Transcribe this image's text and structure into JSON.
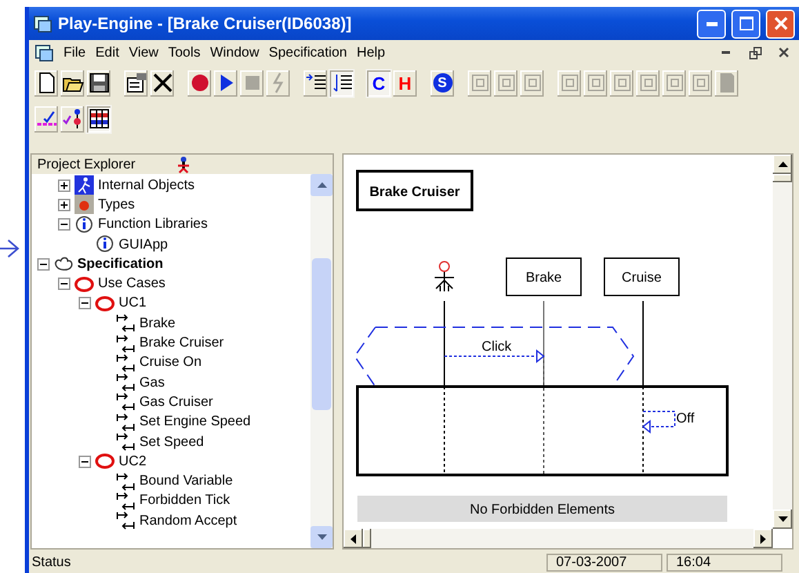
{
  "window": {
    "title": "Play-Engine - [Brake Cruiser(ID6038)]"
  },
  "menu": [
    "File",
    "Edit",
    "View",
    "Tools",
    "Window",
    "Specification",
    "Help"
  ],
  "toolbar_rows": [
    [
      {
        "kind": "new",
        "disabled": false
      },
      {
        "kind": "open",
        "disabled": false
      },
      {
        "kind": "save",
        "disabled": false
      },
      {
        "kind": "gap"
      },
      {
        "kind": "properties",
        "disabled": false
      },
      {
        "kind": "delete",
        "disabled": false
      },
      {
        "kind": "gap"
      },
      {
        "kind": "record",
        "disabled": false
      },
      {
        "kind": "play",
        "disabled": false
      },
      {
        "kind": "stop",
        "disabled": true
      },
      {
        "kind": "step",
        "disabled": true
      },
      {
        "kind": "gap"
      },
      {
        "kind": "list-in",
        "disabled": false
      },
      {
        "kind": "list-out",
        "disabled": false,
        "pressed": true
      },
      {
        "kind": "gap"
      },
      {
        "kind": "letter",
        "text": "C",
        "color": "#0000ff",
        "disabled": false,
        "pressed": true
      },
      {
        "kind": "letter",
        "text": "H",
        "color": "#ff0000",
        "disabled": false
      },
      {
        "kind": "gap"
      },
      {
        "kind": "letter-circle",
        "text": "S",
        "disabled": false
      },
      {
        "kind": "gap"
      },
      {
        "kind": "frame",
        "disabled": true
      },
      {
        "kind": "frame",
        "disabled": true
      },
      {
        "kind": "frame",
        "disabled": true
      },
      {
        "kind": "gap"
      },
      {
        "kind": "frame",
        "disabled": true
      },
      {
        "kind": "frame",
        "disabled": true
      },
      {
        "kind": "frame",
        "disabled": true
      },
      {
        "kind": "frame",
        "disabled": true
      },
      {
        "kind": "frame",
        "disabled": true
      },
      {
        "kind": "frame",
        "disabled": true
      },
      {
        "kind": "page",
        "disabled": true
      }
    ],
    [
      {
        "kind": "check-line",
        "disabled": false
      },
      {
        "kind": "check-actor",
        "disabled": false
      },
      {
        "kind": "grid",
        "disabled": false,
        "pressed": true
      }
    ]
  ],
  "explorer": {
    "title": "Project Explorer",
    "tree": [
      {
        "label": "Internal Objects",
        "kind": "objects",
        "expanded": false
      },
      {
        "label": "Types",
        "kind": "types",
        "expanded": false
      },
      {
        "label": "Function Libraries",
        "kind": "library",
        "expanded": true,
        "children": [
          {
            "label": "GUIApp",
            "kind": "library"
          }
        ]
      }
    ],
    "spec": {
      "label": "Specification",
      "kind": "spec",
      "expanded": true,
      "children": [
        {
          "label": "Use Cases",
          "kind": "usecase",
          "expanded": true,
          "children": [
            {
              "label": "UC1",
              "kind": "usecase",
              "expanded": true,
              "children": [
                {
                  "label": "Brake",
                  "kind": "chart"
                },
                {
                  "label": "Brake Cruiser",
                  "kind": "chart"
                },
                {
                  "label": "Cruise On",
                  "kind": "chart"
                },
                {
                  "label": "Gas",
                  "kind": "chart"
                },
                {
                  "label": "Gas Cruiser",
                  "kind": "chart"
                },
                {
                  "label": "Set Engine Speed",
                  "kind": "chart"
                },
                {
                  "label": "Set Speed",
                  "kind": "chart"
                }
              ]
            },
            {
              "label": "UC2",
              "kind": "usecase",
              "expanded": true,
              "children": [
                {
                  "label": "Bound Variable",
                  "kind": "chart"
                },
                {
                  "label": "Forbidden Tick",
                  "kind": "chart"
                },
                {
                  "label": "Random Accept",
                  "kind": "chart"
                }
              ]
            }
          ]
        }
      ]
    }
  },
  "diagram": {
    "title": "Brake Cruiser",
    "objects": [
      "Brake",
      "Cruise"
    ],
    "messages": [
      {
        "label": "Click",
        "kind": "hot"
      },
      {
        "label": "Off",
        "kind": "self"
      }
    ],
    "forbidden": "No Forbidden Elements"
  },
  "status_bar": {
    "text": "Status",
    "date": "07-03-2007",
    "time": "16:04"
  }
}
